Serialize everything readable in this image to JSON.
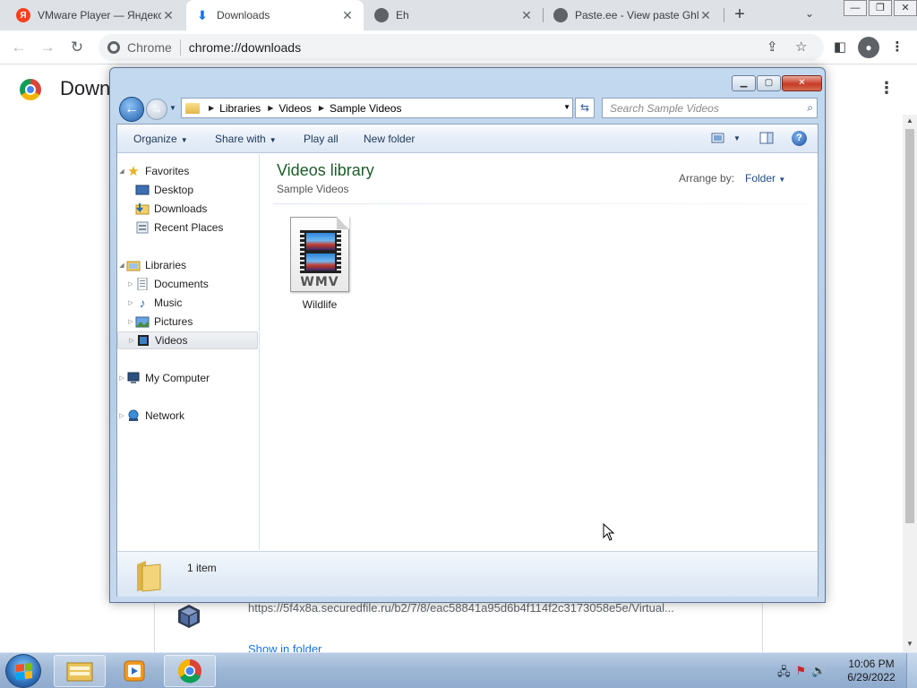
{
  "browser": {
    "tabs": [
      {
        "title": "VMware Player — Яндекс",
        "favicon": "yandex-icon"
      },
      {
        "title": "Downloads",
        "favicon": "download-icon"
      },
      {
        "title": "Eh",
        "favicon": "globe-icon"
      },
      {
        "title": "Paste.ee - View paste Ghl",
        "favicon": "globe-icon"
      }
    ],
    "new_tab": "+",
    "omnibox": {
      "site": "Chrome",
      "url": "chrome://downloads"
    }
  },
  "downloads_page": {
    "title": "Down",
    "item_url": "https://5f4x8a.securedfile.ru/b2/7/8/eac58841a95d6b4f114f2c3173058e5e/Virtual...",
    "show_in_folder": "Show in folder"
  },
  "explorer": {
    "breadcrumb": [
      "Libraries",
      "Videos",
      "Sample Videos"
    ],
    "search_placeholder": "Search Sample Videos",
    "commands": {
      "organize": "Organize",
      "share_with": "Share with",
      "play_all": "Play all",
      "new_folder": "New folder"
    },
    "nav": {
      "favorites": "Favorites",
      "desktop": "Desktop",
      "downloads": "Downloads",
      "recent_places": "Recent Places",
      "libraries": "Libraries",
      "documents": "Documents",
      "music": "Music",
      "pictures": "Pictures",
      "videos": "Videos",
      "my_computer": "My Computer",
      "network": "Network"
    },
    "library": {
      "title": "Videos library",
      "subtitle": "Sample Videos",
      "arrange_label": "Arrange by:",
      "arrange_value": "Folder"
    },
    "files": [
      {
        "name": "Wildlife",
        "ext": "WMV",
        "icon": "video-file-icon"
      }
    ],
    "details": {
      "count": "1 item"
    }
  },
  "taskbar": {
    "clock_time": "10:06 PM",
    "clock_date": "6/29/2022"
  },
  "colors": {
    "chrome_tabbar": "#dee1e6",
    "explorer_frame": "#c3d9ef",
    "library_title": "#1e5d2b",
    "link": "#1a73e8",
    "taskbar": "#9fb8d6"
  }
}
